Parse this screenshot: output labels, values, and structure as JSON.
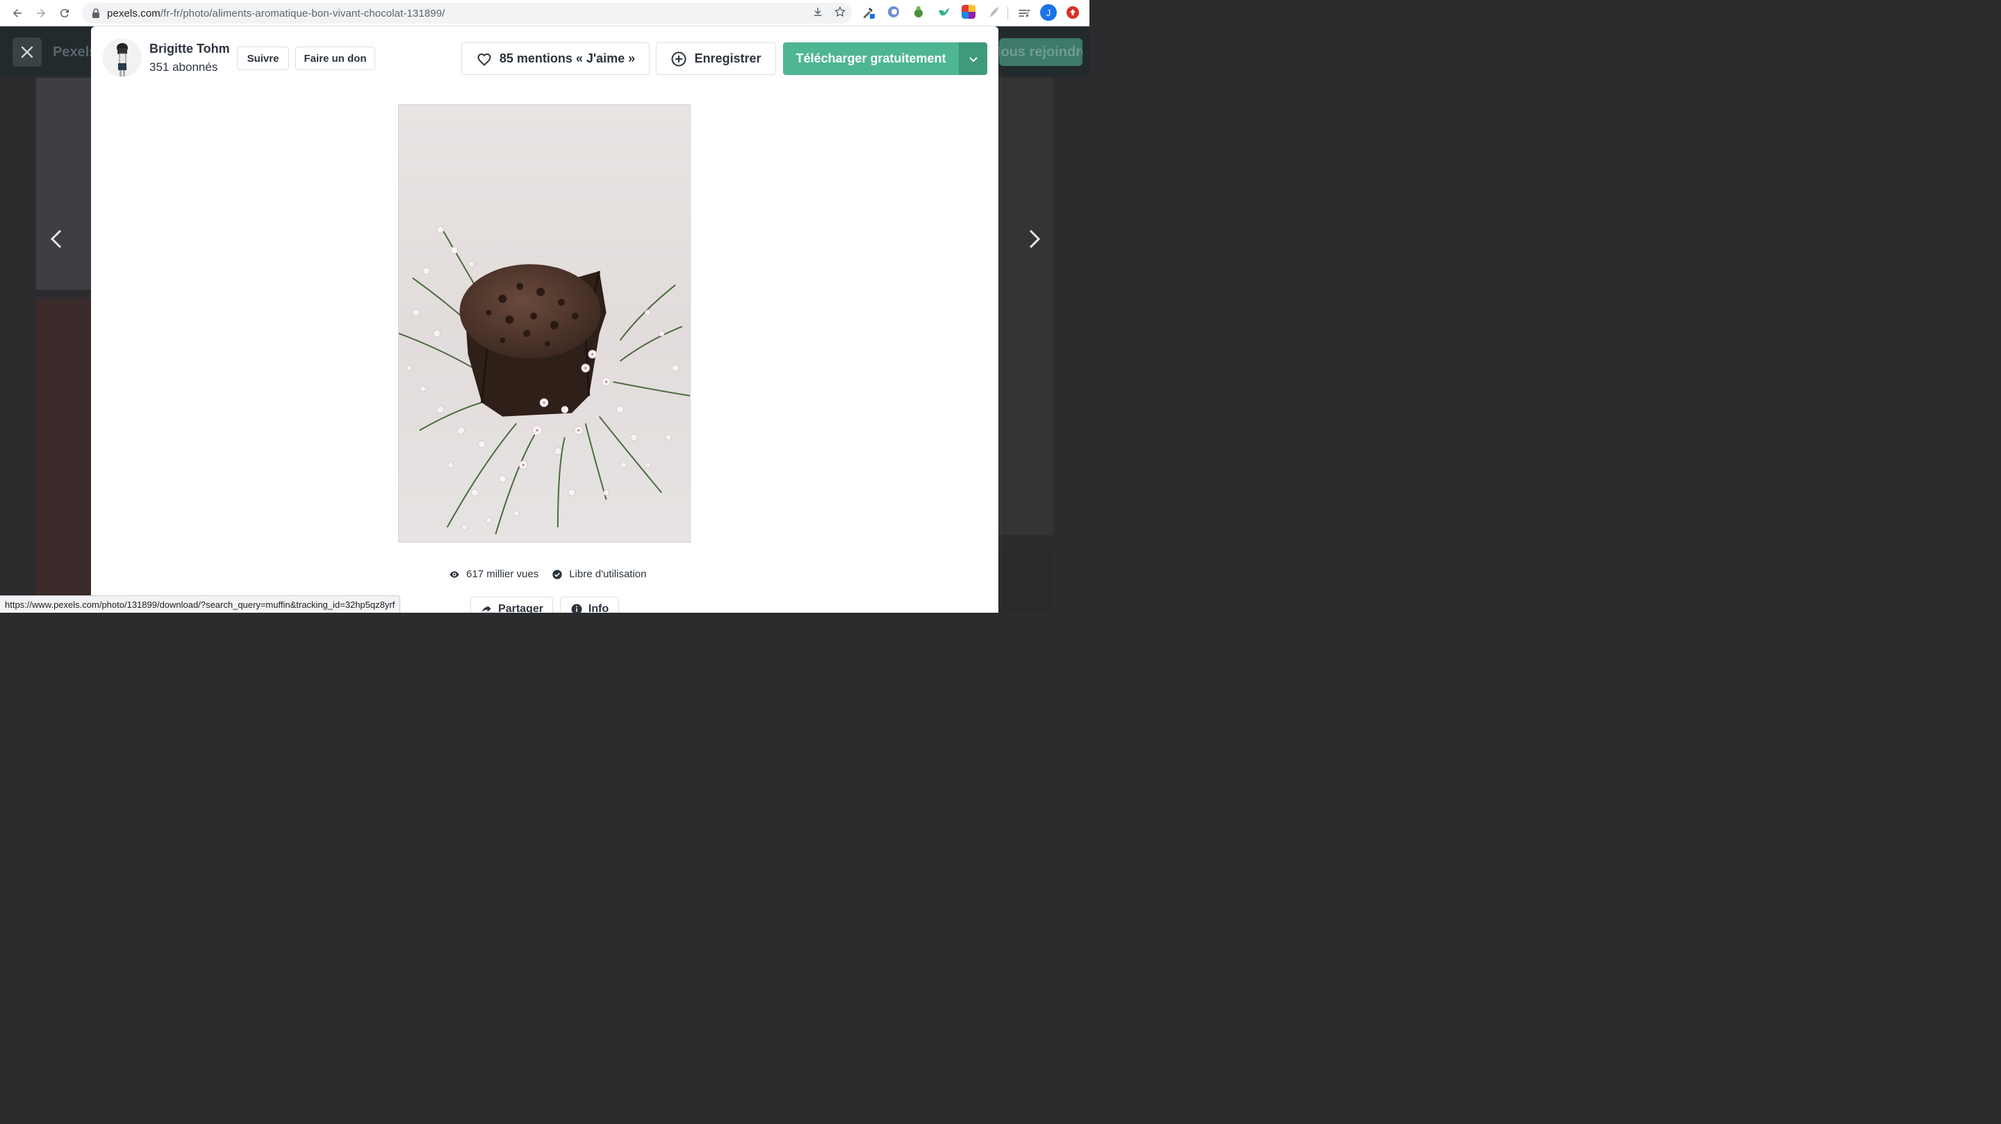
{
  "browser": {
    "url_host": "pexels.com",
    "url_path": "/fr-fr/photo/aliments-aromatique-bon-vivant-chocolat-131899/",
    "profile_initial": "J",
    "icons": [
      "back-icon",
      "forward-icon",
      "reload-icon",
      "lock-icon",
      "download-icon",
      "bookmark-star-icon",
      "eyedropper-extension-icon",
      "circle-extension-icon",
      "frog-extension-icon",
      "bird-extension-icon",
      "color-grid-extension-icon",
      "feather-extension-icon",
      "reading-list-icon",
      "update-icon"
    ]
  },
  "background": {
    "logo_text": "Pexels",
    "join_label": "Nous rejoindre"
  },
  "author": {
    "name": "Brigitte Tohm",
    "followers": "351 abonnés",
    "follow_label": "Suivre",
    "donate_label": "Faire un don"
  },
  "actions": {
    "like_label": "85 mentions « J'aime »",
    "save_label": "Enregistrer",
    "download_label": "Télécharger gratuitement"
  },
  "photo": {
    "subject": "chocolate muffin with white flowers"
  },
  "stats": {
    "views": "617 millier vues",
    "license": "Libre d'utilisation"
  },
  "footer_buttons": {
    "share_label": "Partager",
    "info_label": "Info"
  },
  "status_url": "https://www.pexels.com/photo/131899/download/?search_query=muffin&tracking_id=32hp5qz8yrf",
  "colors": {
    "accent_green": "#4fb692",
    "accent_green_dark": "#3f9a7b",
    "overlay": "#2c2c2e"
  }
}
